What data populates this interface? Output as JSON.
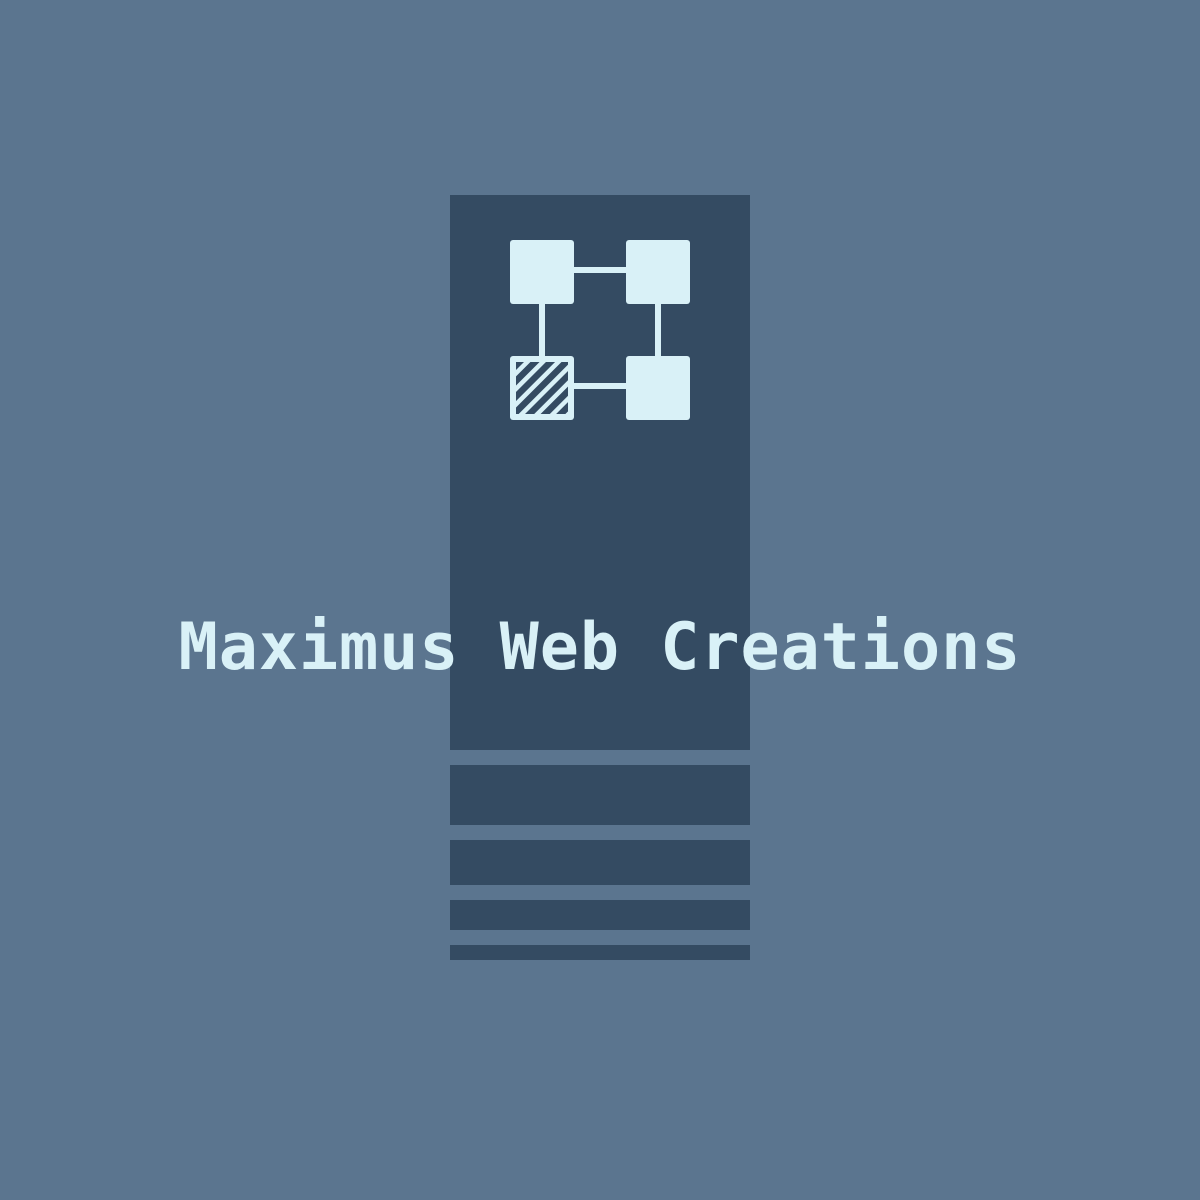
{
  "brand": {
    "name": "Maximus Web Creations"
  },
  "colors": {
    "background": "#5b758f",
    "panel": "#344b62",
    "accent": "#d9f1f7"
  },
  "emblem": {
    "icon": "node-network-icon"
  }
}
